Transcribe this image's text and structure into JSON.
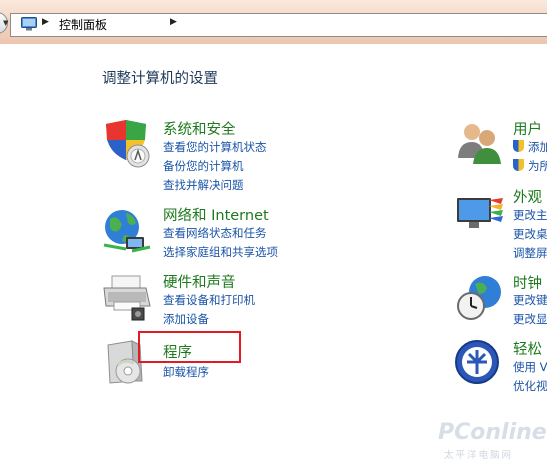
{
  "address_bar": {
    "breadcrumb": "控制面板"
  },
  "page": {
    "title": "调整计算机的设置"
  },
  "categories_left": [
    {
      "title": "系统和安全",
      "links": [
        "查看您的计算机状态",
        "备份您的计算机",
        "查找并解决问题"
      ]
    },
    {
      "title": "网络和 Internet",
      "links": [
        "查看网络状态和任务",
        "选择家庭组和共享选项"
      ]
    },
    {
      "title": "硬件和声音",
      "links": [
        "查看设备和打印机",
        "添加设备"
      ]
    },
    {
      "title": "程序",
      "links": [
        "卸载程序"
      ]
    }
  ],
  "categories_right": [
    {
      "title": "用户",
      "links": [
        "添加",
        "为所"
      ]
    },
    {
      "title": "外观",
      "links": [
        "更改主",
        "更改桌",
        "调整屏"
      ]
    },
    {
      "title": "时钟",
      "links": [
        "更改键",
        "更改显"
      ]
    },
    {
      "title": "轻松",
      "links": [
        "使用 V",
        "优化视"
      ]
    }
  ],
  "watermark": {
    "main": "PConline",
    "sub": "太平洋电脑网"
  },
  "colors": {
    "category_title": "#1e7a1e",
    "link": "#1a54a8",
    "page_title": "#1e395b",
    "highlight": "#e01b24"
  }
}
